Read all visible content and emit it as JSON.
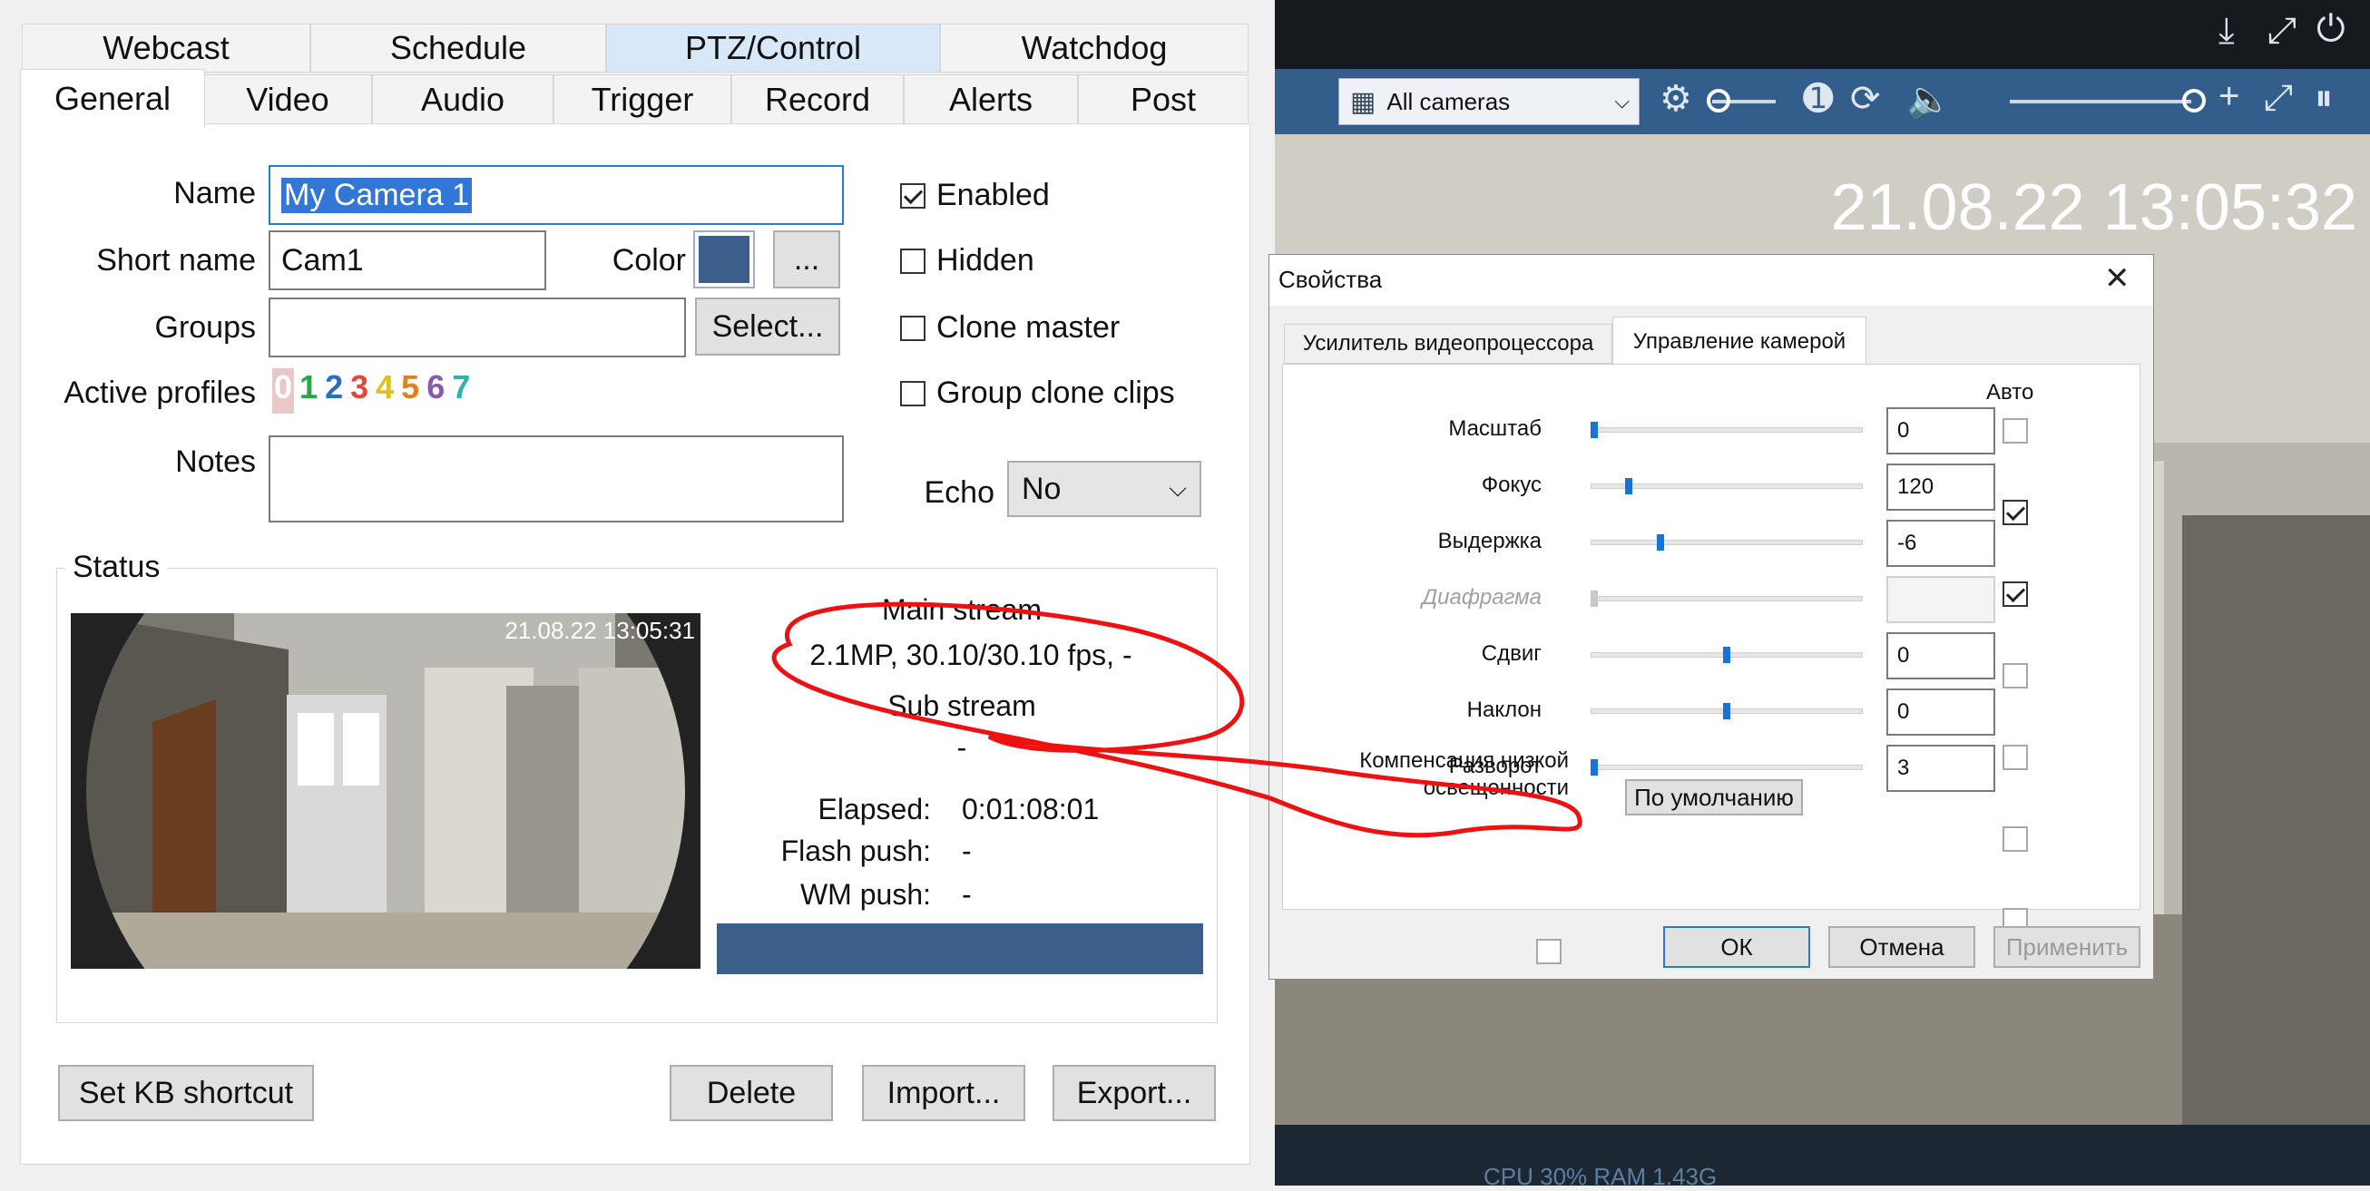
{
  "top_tabs": [
    "Webcast",
    "Schedule",
    "PTZ/Control",
    "Watchdog"
  ],
  "tabs": [
    "General",
    "Video",
    "Audio",
    "Trigger",
    "Record",
    "Alerts",
    "Post"
  ],
  "general": {
    "name_label": "Name",
    "name_value": "My Camera 1",
    "short_name_label": "Short name",
    "short_name_value": "Cam1",
    "color_label": "Color",
    "color_value": "#3c5e8b",
    "color_btn": "...",
    "groups_label": "Groups",
    "groups_value": "",
    "select_btn": "Select...",
    "profiles_label": "Active profiles",
    "profiles": [
      {
        "label": "0",
        "color": "#d9a0a0"
      },
      {
        "label": "1",
        "color": "#28a745"
      },
      {
        "label": "2",
        "color": "#2b6cc4"
      },
      {
        "label": "3",
        "color": "#e04a3a"
      },
      {
        "label": "4",
        "color": "#e0c020"
      },
      {
        "label": "5",
        "color": "#e08020"
      },
      {
        "label": "6",
        "color": "#8a5ab0"
      },
      {
        "label": "7",
        "color": "#30b0b0"
      }
    ],
    "notes_label": "Notes",
    "notes_value": "",
    "enabled_label": "Enabled",
    "hidden_label": "Hidden",
    "clone_label": "Clone master",
    "group_clone_label": "Group clone clips",
    "echo_label": "Echo",
    "echo_value": "No"
  },
  "status": {
    "label": "Status",
    "thumb_time": "21.08.22 13:05:31",
    "main_stream": "Main stream",
    "main_info": "2.1MP, 30.10/30.10 fps, -",
    "sub_stream": "Sub stream",
    "sub_info": "-",
    "elapsed_label": "Elapsed:",
    "elapsed_value": "0:01:08:01",
    "flash_label": "Flash push:",
    "flash_value": "-",
    "wm_label": "WM push:",
    "wm_value": "-"
  },
  "buttons": {
    "kb": "Set KB shortcut",
    "delete": "Delete",
    "import": "Import...",
    "export": "Export..."
  },
  "viewer": {
    "cameras": "All cameras",
    "timestamp": "21.08.22 13:05:32",
    "statusbar": "CPU 30% RAM 1.43G"
  },
  "props": {
    "title": "Свойства",
    "tab1": "Усилитель видеопроцессора",
    "tab2": "Управление камерой",
    "auto": "Авто",
    "rows": [
      {
        "label": "Масштаб",
        "value": "0",
        "auto": false,
        "pos": 0.0
      },
      {
        "label": "Фокус",
        "value": "120",
        "auto": true,
        "pos": 0.13
      },
      {
        "label": "Выдержка",
        "value": "-6",
        "auto": true,
        "pos": 0.25
      },
      {
        "label": "Диафрагма",
        "value": "",
        "auto": false,
        "pos": 0.0,
        "disabled": true
      },
      {
        "label": "Сдвиг",
        "value": "0",
        "auto": false,
        "pos": 0.5
      },
      {
        "label": "Наклон",
        "value": "0",
        "auto": false,
        "pos": 0.5
      },
      {
        "label": "Разворот",
        "value": "3",
        "auto": false,
        "pos": 0.0
      }
    ],
    "low_light_1": "Компенсация низкой",
    "low_light_2": "освещенности",
    "default_btn": "По умолчанию",
    "ok": "ОК",
    "cancel": "Отмена",
    "apply": "Применить"
  }
}
